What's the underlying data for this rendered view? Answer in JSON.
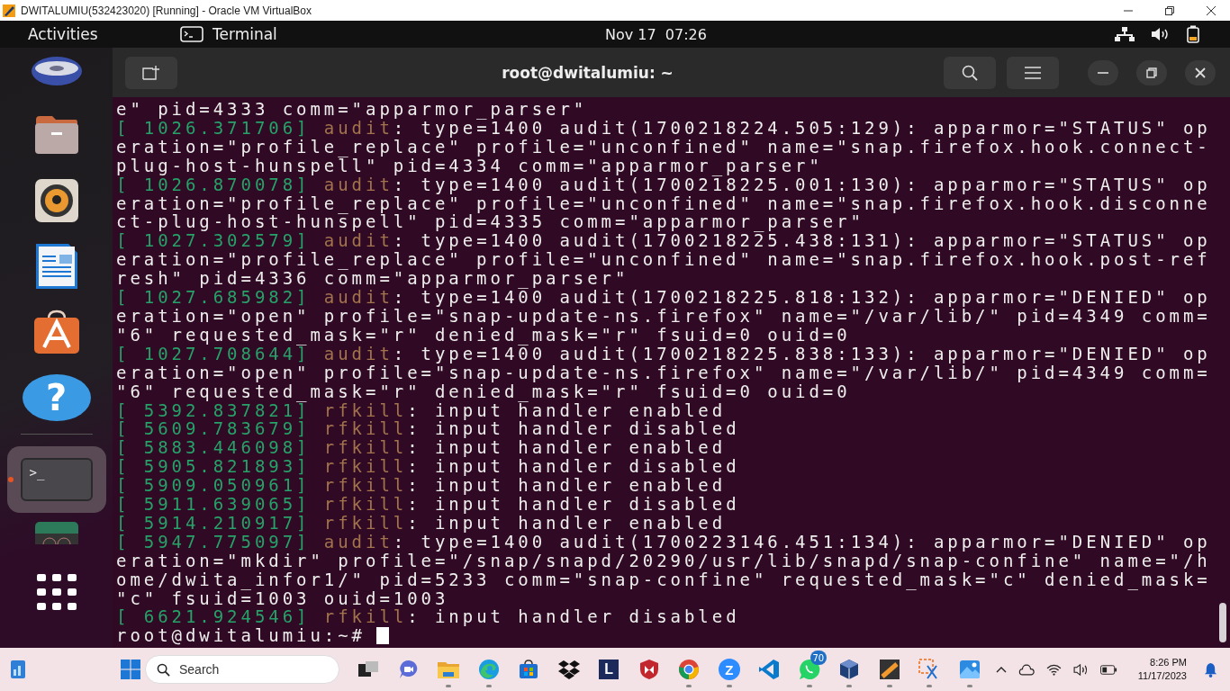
{
  "vbox_window": {
    "title": "DWITALUMIU(532423020) [Running] - Oracle VM VirtualBox"
  },
  "top_bar": {
    "activities": "Activities",
    "app": "Terminal",
    "clock": "Nov 17  07:26"
  },
  "dock": {
    "items": [
      {
        "kind": "disc",
        "selected": false
      },
      {
        "kind": "files",
        "selected": false
      },
      {
        "kind": "speaker",
        "selected": false
      },
      {
        "kind": "writer",
        "selected": false
      },
      {
        "kind": "store",
        "selected": false
      },
      {
        "kind": "help",
        "glyph": "?",
        "selected": false
      },
      {
        "kind": "terminal",
        "glyph": ">_",
        "selected": true
      },
      {
        "kind": "partial",
        "selected": false
      },
      {
        "kind": "apps",
        "selected": false
      }
    ]
  },
  "terminal": {
    "title": "root@dwitalumiu: ~",
    "prompt": "root@dwitalumiu:~#",
    "lines": [
      {
        "text": "e\" pid=4333 comm=\"apparmor_parser\""
      },
      {
        "ts": "[ 1026.371706]",
        "src": "audit",
        "text": ": type=1400 audit(1700218224.505:129): apparmor=\"STATUS\" op"
      },
      {
        "text": "eration=\"profile_replace\" profile=\"unconfined\" name=\"snap.firefox.hook.connect-"
      },
      {
        "text": "plug-host-hunspell\" pid=4334 comm=\"apparmor_parser\""
      },
      {
        "ts": "[ 1026.870078]",
        "src": "audit",
        "text": ": type=1400 audit(1700218225.001:130): apparmor=\"STATUS\" op"
      },
      {
        "text": "eration=\"profile_replace\" profile=\"unconfined\" name=\"snap.firefox.hook.disconne"
      },
      {
        "text": "ct-plug-host-hunspell\" pid=4335 comm=\"apparmor_parser\""
      },
      {
        "ts": "[ 1027.302579]",
        "src": "audit",
        "text": ": type=1400 audit(1700218225.438:131): apparmor=\"STATUS\" op"
      },
      {
        "text": "eration=\"profile_replace\" profile=\"unconfined\" name=\"snap.firefox.hook.post-ref"
      },
      {
        "text": "resh\" pid=4336 comm=\"apparmor_parser\""
      },
      {
        "ts": "[ 1027.685982]",
        "src": "audit",
        "text": ": type=1400 audit(1700218225.818:132): apparmor=\"DENIED\" op"
      },
      {
        "text": "eration=\"open\" profile=\"snap-update-ns.firefox\" name=\"/var/lib/\" pid=4349 comm="
      },
      {
        "text": "\"6\" requested_mask=\"r\" denied_mask=\"r\" fsuid=0 ouid=0"
      },
      {
        "ts": "[ 1027.708644]",
        "src": "audit",
        "text": ": type=1400 audit(1700218225.838:133): apparmor=\"DENIED\" op"
      },
      {
        "text": "eration=\"open\" profile=\"snap-update-ns.firefox\" name=\"/var/lib/\" pid=4349 comm="
      },
      {
        "text": "\"6\" requested_mask=\"r\" denied_mask=\"r\" fsuid=0 ouid=0"
      },
      {
        "ts": "[ 5392.837821]",
        "src": "rfkill",
        "text": ": input handler enabled"
      },
      {
        "ts": "[ 5609.783679]",
        "src": "rfkill",
        "text": ": input handler disabled"
      },
      {
        "ts": "[ 5883.446098]",
        "src": "rfkill",
        "text": ": input handler enabled"
      },
      {
        "ts": "[ 5905.821893]",
        "src": "rfkill",
        "text": ": input handler disabled"
      },
      {
        "ts": "[ 5909.050961]",
        "src": "rfkill",
        "text": ": input handler enabled"
      },
      {
        "ts": "[ 5911.639065]",
        "src": "rfkill",
        "text": ": input handler disabled"
      },
      {
        "ts": "[ 5914.210917]",
        "src": "rfkill",
        "text": ": input handler enabled"
      },
      {
        "ts": "[ 5947.775097]",
        "src": "audit",
        "text": ": type=1400 audit(1700223146.451:134): apparmor=\"DENIED\" op"
      },
      {
        "text": "eration=\"mkdir\" profile=\"/snap/snapd/20290/usr/lib/snapd/snap-confine\" name=\"/h"
      },
      {
        "text": "ome/dwita_infor1/\" pid=5233 comm=\"snap-confine\" requested_mask=\"c\" denied_mask="
      },
      {
        "text": "\"c\" fsuid=1003 ouid=1003"
      },
      {
        "ts": "[ 6621.924546]",
        "src": "rfkill",
        "text": ": input handler disabled"
      }
    ]
  },
  "taskbar": {
    "search_placeholder": "Search",
    "apps": [
      {
        "kind": "taskview",
        "running": false
      },
      {
        "kind": "meet",
        "running": false
      },
      {
        "kind": "folder",
        "running": true
      },
      {
        "kind": "edge",
        "running": true
      },
      {
        "kind": "store",
        "running": false
      },
      {
        "kind": "dropbox",
        "running": false
      },
      {
        "kind": "letter",
        "glyph": "L",
        "running": false
      },
      {
        "kind": "shield",
        "running": false
      },
      {
        "kind": "chrome",
        "running": true
      },
      {
        "kind": "zoom",
        "glyph": "Z",
        "running": true
      },
      {
        "kind": "vscode",
        "running": false
      },
      {
        "kind": "whatsapp",
        "badge": "70",
        "running": true
      },
      {
        "kind": "virtualbox",
        "running": true
      },
      {
        "kind": "cfour",
        "running": true
      },
      {
        "kind": "snip",
        "running": true
      },
      {
        "kind": "photos",
        "running": true
      }
    ],
    "time": "8:26 PM",
    "date": "11/17/2023"
  }
}
